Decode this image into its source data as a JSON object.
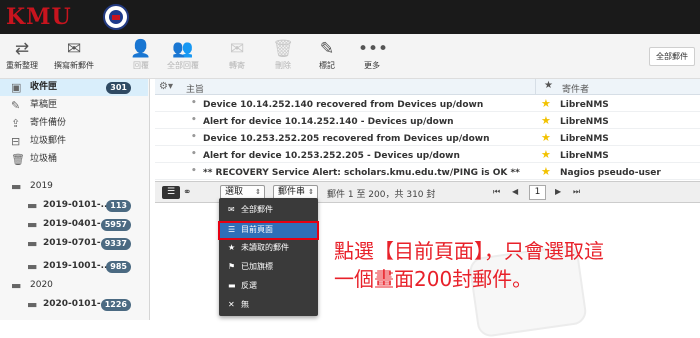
{
  "logo": {
    "text": "KMU"
  },
  "toolbar": {
    "buttons": [
      {
        "label": "重新整理",
        "icon": "refresh-icon",
        "enabled": true
      },
      {
        "label": "撰寫新郵件",
        "icon": "compose-icon",
        "enabled": true
      },
      {
        "label": "回覆",
        "icon": "reply-icon",
        "enabled": false
      },
      {
        "label": "全部回覆",
        "icon": "reply-all-icon",
        "enabled": false
      },
      {
        "label": "轉寄",
        "icon": "forward-icon",
        "enabled": false
      },
      {
        "label": "刪除",
        "icon": "trash-icon",
        "enabled": false
      },
      {
        "label": "標記",
        "icon": "mark-icon",
        "enabled": true
      },
      {
        "label": "更多",
        "icon": "more-icon",
        "enabled": true
      }
    ],
    "all_mail_label": "全部郵件"
  },
  "sidebar": {
    "folders": [
      {
        "name": "收件匣",
        "icon": "inbox-icon",
        "badge": "301",
        "selected": true
      },
      {
        "name": "草稿匣",
        "icon": "pencil-icon"
      },
      {
        "name": "寄件備份",
        "icon": "sent-icon"
      },
      {
        "name": "垃圾郵件",
        "icon": "spam-icon"
      },
      {
        "name": "垃圾桶",
        "icon": "trash-icon"
      },
      {
        "name": "2019",
        "icon": "folder-icon"
      },
      {
        "name": "2019-0101-...",
        "icon": "folder-icon",
        "badge": "113",
        "sub": true
      },
      {
        "name": "2019-0401-...",
        "icon": "folder-icon",
        "badge": "5957",
        "sub": true
      },
      {
        "name": "2019-0701-...",
        "icon": "folder-icon",
        "badge": "9337",
        "sub": true
      },
      {
        "name": "2019-1001-...",
        "icon": "folder-icon",
        "badge": "985",
        "sub": true
      },
      {
        "name": "2020",
        "icon": "folder-icon"
      },
      {
        "name": "2020-0101-...",
        "icon": "folder-icon",
        "badge": "1226",
        "sub": true
      }
    ]
  },
  "list": {
    "header_subject": "主旨",
    "header_from": "寄件者",
    "rows": [
      {
        "subject": "Device 10.14.252.140 recovered from Devices up/down",
        "from": "LibreNMS"
      },
      {
        "subject": "Alert for device 10.14.252.140 - Devices up/down",
        "from": "LibreNMS"
      },
      {
        "subject": "Device 10.253.252.205 recovered from Devices up/down",
        "from": "LibreNMS"
      },
      {
        "subject": "Alert for device 10.253.252.205 - Devices up/down",
        "from": "LibreNMS"
      },
      {
        "subject": "** RECOVERY Service Alert: scholars.kmu.edu.tw/PING is OK **",
        "from": "Nagios pseudo-user"
      }
    ],
    "footer": {
      "select_label": "選取",
      "thread_label": "郵件串",
      "count_text": "郵件 1 至 200，共 310 封",
      "page": "1"
    }
  },
  "dropdown": {
    "items": [
      {
        "label": "全部郵件",
        "icon": "mail-icon"
      },
      {
        "label": "目前頁面",
        "icon": "list-icon",
        "active": true
      },
      {
        "label": "未讀取的郵件",
        "icon": "star-icon"
      },
      {
        "label": "已加旗標",
        "icon": "flag-icon"
      },
      {
        "label": "反選",
        "icon": "invert-icon"
      },
      {
        "label": "無",
        "icon": "close-icon"
      }
    ]
  },
  "annotation": {
    "line1": "點選【目前頁面】，只會選取這",
    "line2": "一個畫面200封郵件。",
    "color": "#e8212a"
  }
}
